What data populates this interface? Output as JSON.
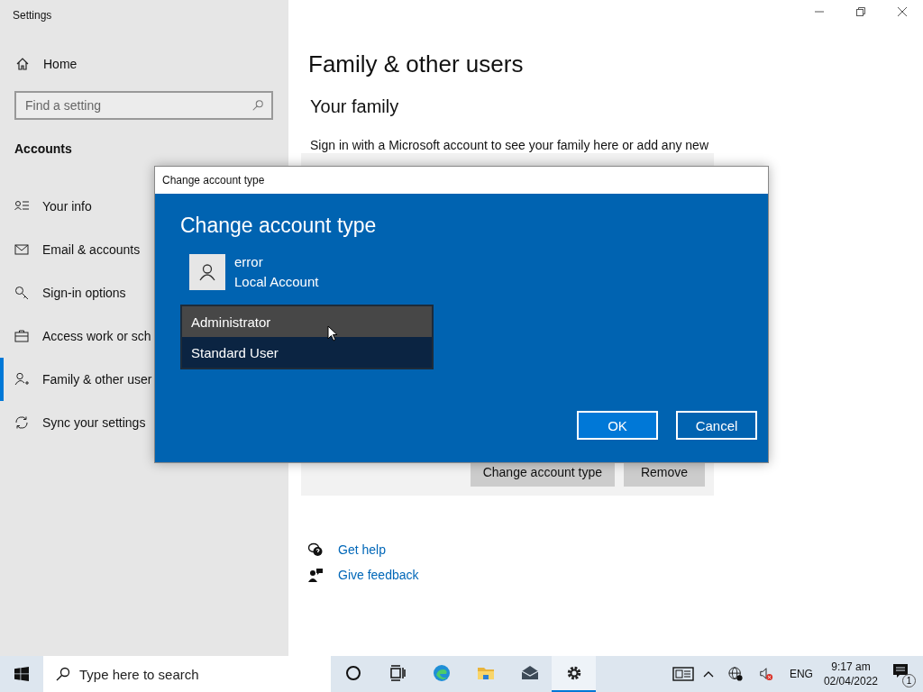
{
  "window": {
    "title": "Settings"
  },
  "sidebar": {
    "home": "Home",
    "search": {
      "placeholder": "Find a setting"
    },
    "section": "Accounts",
    "items": [
      {
        "label": "Your info",
        "selected": false
      },
      {
        "label": "Email & accounts",
        "selected": false
      },
      {
        "label": "Sign-in options",
        "selected": false
      },
      {
        "label": "Access work or sch",
        "selected": false
      },
      {
        "label": "Family & other user",
        "selected": true
      },
      {
        "label": "Sync your settings",
        "selected": false
      }
    ]
  },
  "main": {
    "title": "Family & other users",
    "section": "Your family",
    "description": "Sign in with a Microsoft account to see your family here or add any new",
    "card_buttons": [
      "Change account type",
      "Remove"
    ],
    "links": [
      "Get help",
      "Give feedback"
    ]
  },
  "dialog": {
    "title": "Change account type",
    "heading": "Change account type",
    "user": {
      "name": "error",
      "type": "Local Account"
    },
    "options": [
      {
        "label": "Administrator",
        "selected": false
      },
      {
        "label": "Standard User",
        "selected": true
      }
    ],
    "buttons": [
      {
        "label": "OK",
        "kind": "primary"
      },
      {
        "label": "Cancel",
        "kind": "secondary"
      }
    ]
  },
  "taskbar": {
    "search": {
      "placeholder": "Type here to search"
    },
    "apps": [
      {
        "active": false
      },
      {
        "active": false
      },
      {
        "active": false
      },
      {
        "active": false
      },
      {
        "active": false
      },
      {
        "active": true
      }
    ],
    "language": "ENG",
    "time": "9:17 am",
    "date": "02/04/2022",
    "notifications": "1"
  }
}
